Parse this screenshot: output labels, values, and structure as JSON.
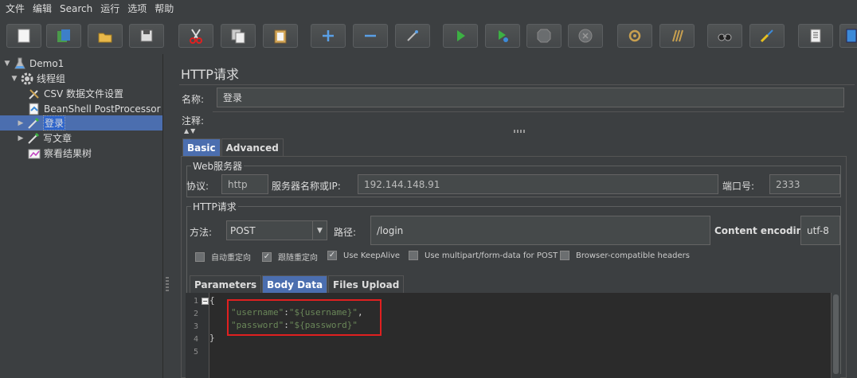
{
  "menu": [
    "文件",
    "编辑",
    "Search",
    "运行",
    "选项",
    "帮助"
  ],
  "toolbar": {
    "buttons": [
      "new-icon",
      "templates-icon",
      "open-icon",
      "save-icon",
      "cut-icon",
      "copy-icon",
      "paste-icon",
      "expand-icon",
      "collapse-icon",
      "toggle-icon",
      "start-icon",
      "start-no-pause-icon",
      "stop-icon",
      "shutdown-icon",
      "clear-icon",
      "clear-all-icon",
      "search-icon",
      "reset-search-icon",
      "function-helper-icon",
      "help-icon"
    ]
  },
  "tree": {
    "nodes": [
      {
        "label": "Demo1",
        "icon": "test-plan-icon",
        "arrow": "▼"
      },
      {
        "label": "线程组",
        "icon": "gear-icon",
        "arrow": "▼"
      },
      {
        "label": "CSV 数据文件设置",
        "icon": "wrench-icon",
        "arrow": ""
      },
      {
        "label": "BeanShell PostProcessor",
        "icon": "script-icon",
        "arrow": ""
      },
      {
        "label": "登录",
        "icon": "pipette-icon",
        "arrow": "▶"
      },
      {
        "label": "写文章",
        "icon": "pipette-icon",
        "arrow": "▶"
      },
      {
        "label": "察看结果树",
        "icon": "chart-icon",
        "arrow": ""
      }
    ]
  },
  "panel": {
    "title": "HTTP请求",
    "name_label": "名称:",
    "name_value": "登录",
    "comment_label": "注释:",
    "comment_value": "",
    "tabs": [
      "Basic",
      "Advanced"
    ],
    "web_server": {
      "title": "Web服务器",
      "protocol_label": "协议:",
      "protocol_value": "http",
      "server_label": "服务器名称或IP:",
      "server_value": "192.144.148.91",
      "port_label": "端口号:",
      "port_value": "2333"
    },
    "http_request": {
      "title": "HTTP请求",
      "method_label": "方法:",
      "method_value": "POST",
      "path_label": "路径:",
      "path_value": "/login",
      "encoding_label": "Content encoding:",
      "encoding_value": "utf-8",
      "checkboxes": [
        {
          "label": "自动重定向",
          "checked": false
        },
        {
          "label": "跟随重定向",
          "checked": true
        },
        {
          "label": "Use KeepAlive",
          "checked": true
        },
        {
          "label": "Use multipart/form-data for POST",
          "checked": false
        },
        {
          "label": "Browser-compatible headers",
          "checked": false
        }
      ]
    },
    "body_tabs": [
      "Parameters",
      "Body Data",
      "Files Upload"
    ],
    "body": {
      "line_numbers": [
        "1",
        "2",
        "3",
        "4",
        "5"
      ],
      "line1": "{",
      "line2_key": "\"username\"",
      "line2_sep": ":",
      "line2_val": "\"${username}\"",
      "line2_tail": ",",
      "line3_key": "\"password\"",
      "line3_sep": ":",
      "line3_val": "\"${password}\"",
      "line4": "}"
    }
  }
}
